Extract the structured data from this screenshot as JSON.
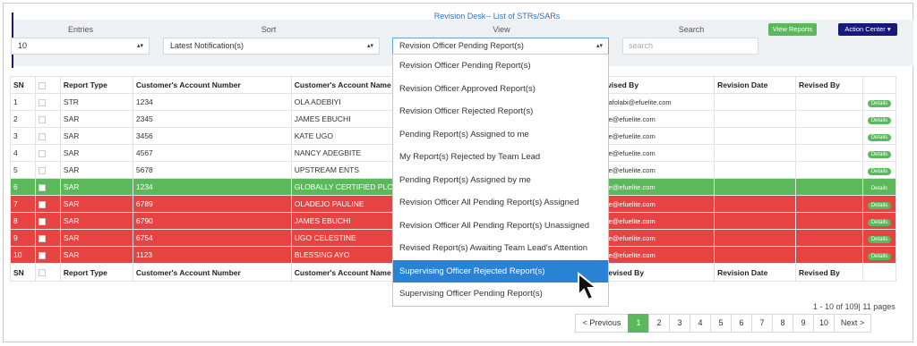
{
  "header": {
    "page_title": "Revision Desk-- List of STRs/SARs",
    "view_reports_label": "View Reports",
    "action_center_label": "Action Center ▾"
  },
  "filters": {
    "entries_label": "Entries",
    "entries_value": "10",
    "sort_label": "Sort",
    "sort_value": "Latest Notification(s)",
    "view_label": "View",
    "view_value": "Revision Officer Pending Report(s)",
    "search_label": "Search",
    "search_placeholder": "search"
  },
  "table": {
    "columns": [
      "SN",
      "",
      "Report Type",
      "Customer's Account Number",
      "Customer's Account Name",
      "",
      "Revised By",
      "Revision Date",
      "Revised By",
      ""
    ],
    "rows": [
      {
        "sn": "1",
        "type": "STR",
        "acct_no": "1234",
        "acct_name": "OLA ADEBIYI",
        "email": "e.afolabi@efuelite.com",
        "action": "Details",
        "style": "plain"
      },
      {
        "sn": "2",
        "type": "SAR",
        "acct_no": "2345",
        "acct_name": "JAMES EBUCHI",
        "email": "fue@efuelite.com",
        "action": "Details",
        "style": "plain"
      },
      {
        "sn": "3",
        "type": "SAR",
        "acct_no": "3456",
        "acct_name": "KATE UGO",
        "email": "fue@efuelite.com",
        "action": "Details",
        "style": "plain"
      },
      {
        "sn": "4",
        "type": "SAR",
        "acct_no": "4567",
        "acct_name": "NANCY ADEGBITE",
        "email": "fue@efuelite.com",
        "action": "Details",
        "style": "plain"
      },
      {
        "sn": "5",
        "type": "SAR",
        "acct_no": "5678",
        "acct_name": "UPSTREAM ENTS",
        "email": "fue@efuelite.com",
        "action": "Details",
        "style": "plain"
      },
      {
        "sn": "6",
        "type": "SAR",
        "acct_no": "1234",
        "acct_name": "GLOBALLY CERTIFIED PLC",
        "email": "fue@efuelite.com",
        "action": "Details",
        "style": "green"
      },
      {
        "sn": "7",
        "type": "SAR",
        "acct_no": "6789",
        "acct_name": "OLADEJO PAULINE",
        "email": "fue@efuelite.com",
        "action": "Details",
        "style": "red"
      },
      {
        "sn": "8",
        "type": "SAR",
        "acct_no": "6790",
        "acct_name": "JAMES EBUCHI",
        "email": "fue@efuelite.com",
        "action": "Details",
        "style": "red"
      },
      {
        "sn": "9",
        "type": "SAR",
        "acct_no": "6754",
        "acct_name": "UGO CELESTINE",
        "email": "fue@efuelite.com",
        "action": "Details",
        "style": "red"
      },
      {
        "sn": "10",
        "type": "SAR",
        "acct_no": "1123",
        "acct_name": "BLESSING AYO",
        "email": "fue@efuelite.com",
        "action": "Details",
        "style": "red"
      }
    ]
  },
  "dropdown": {
    "items": [
      "Revision Officer Pending Report(s)",
      "Revision Officer Approved Report(s)",
      "Revision Officer Rejected Report(s)",
      "Pending Report(s) Assigned to me",
      "My Report(s) Rejected by Team Lead",
      "Pending Report(s) Assigned by me",
      "Revision Officer All Pending Report(s) Assigned",
      "Revision Officer All Pending Report(s) Unassigned",
      "Revised Report(s) Awaiting Team Lead's Attention",
      "Supervising Officer Rejected Report(s)",
      "Supervising Officer Pending Report(s)"
    ],
    "highlighted_index": 9
  },
  "pagination": {
    "info": "1 - 10 of 109| 11 pages",
    "prev_label": "< Previous",
    "pages": [
      "1",
      "2",
      "3",
      "4",
      "5",
      "6",
      "7",
      "8",
      "9",
      "10"
    ],
    "current_page": "1",
    "next_label": "Next >"
  },
  "colors": {
    "green": "#5bb85b",
    "red": "#e84343",
    "accent_blue": "#2a82d4",
    "navy": "#18187a"
  }
}
